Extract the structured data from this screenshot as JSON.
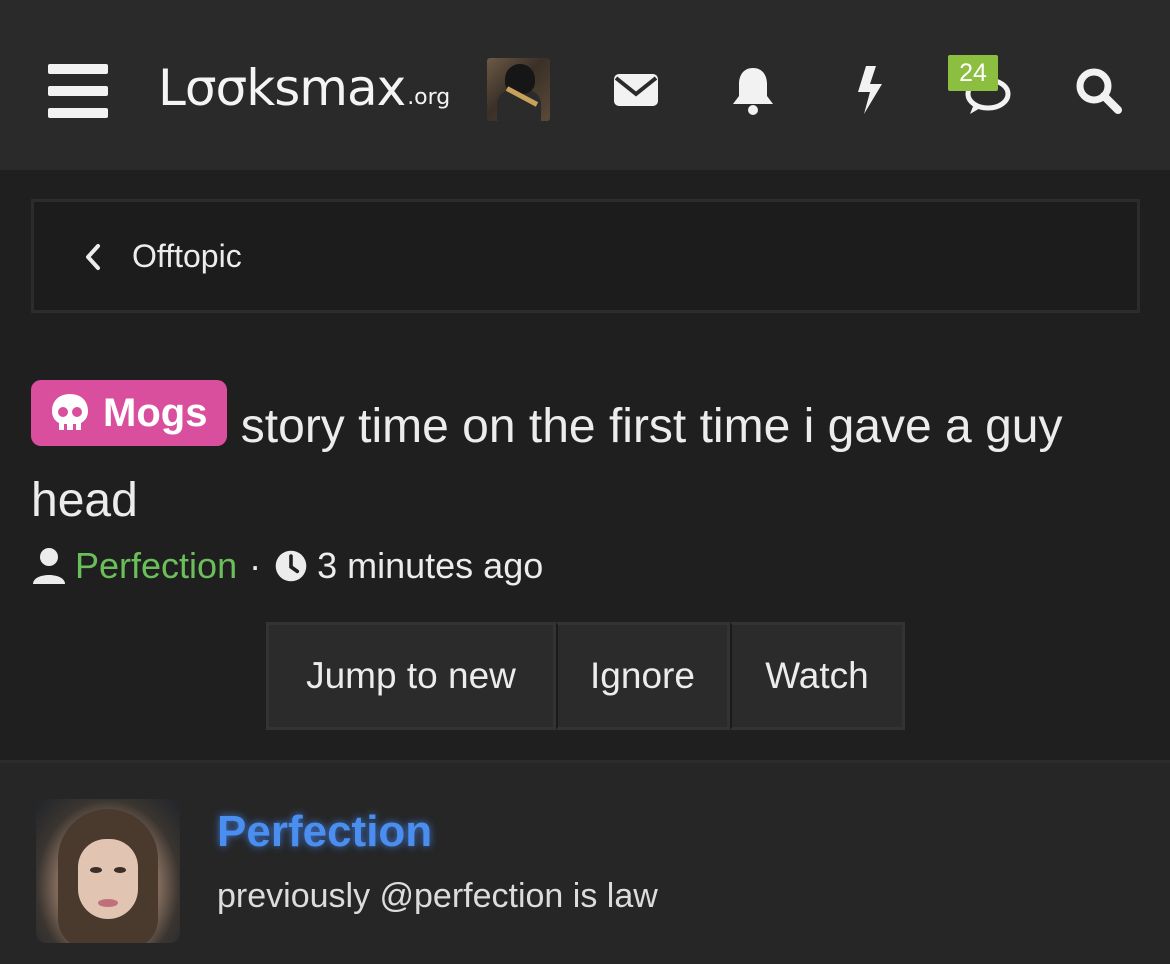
{
  "header": {
    "logo_main": "Lσσksmax",
    "logo_tld": ".org",
    "notifications_badge": "24",
    "icons": [
      "menu-icon",
      "envelope-icon",
      "bell-icon",
      "bolt-icon",
      "chat-icon",
      "search-icon"
    ]
  },
  "breadcrumb": {
    "label": "Offtopic"
  },
  "thread": {
    "prefix": "Mogs",
    "prefix_color": "#d94f9e",
    "title": "story time on the first time i gave a guy head",
    "author": "Perfection",
    "separator": "·",
    "time": "3 minutes ago"
  },
  "actions": {
    "jump": "Jump to new",
    "ignore": "Ignore",
    "watch": "Watch"
  },
  "post": {
    "username": "Perfection",
    "user_title": "previously @perfection is law"
  },
  "colors": {
    "author": "#6bbf5a",
    "username": "#4a8ff0",
    "badge": "#8cbf3f"
  }
}
